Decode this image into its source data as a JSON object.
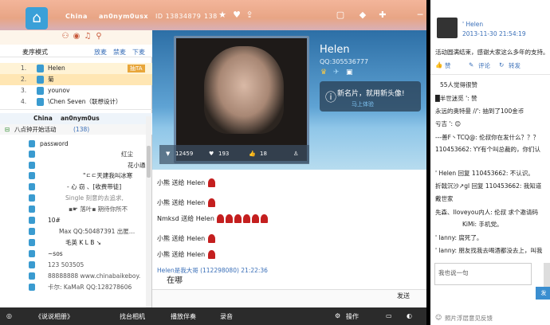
{
  "topbar": {
    "user1": "China",
    "user2": "an0nym0usx",
    "id_label": "ID 13834879",
    "fans_count": "138"
  },
  "left": {
    "mode_label": "麦序模式",
    "mode_options": [
      "放麦",
      "禁麦",
      "下麦"
    ],
    "mic_list": [
      {
        "num": "1.",
        "name": "Helen",
        "badge": "抽TA"
      },
      {
        "num": "2.",
        "name": "菊"
      },
      {
        "num": "3.",
        "name": "younov"
      },
      {
        "num": "4.",
        "name": "\\Chen Seven（联想设计）"
      }
    ],
    "room_head": [
      "China",
      "an0nym0us"
    ],
    "group_label": "八点钟开始活动",
    "group_count": "(138)",
    "members": [
      "password",
      "红尘",
      "花小通",
      "\"ㄷㄷ天建我叫冰寒",
      "- 心 窃 、[收费带徒]",
      "Single  刻意的去追求,",
      "▪☛ 落叶▪ 期待你所不",
      "10#",
      "Max   QQ:50487391  出匿…",
      "毛英  K L B  ↘",
      "~sos",
      "123  503505",
      "88888888  www.chinabaikeboy.",
      "卡尔: KaMaR  QQ:128278606"
    ]
  },
  "stage": {
    "host_name": "Helen",
    "host_qq": "QQ:305536777",
    "card_text": "新名片，就用新头像!",
    "card_link": "马上体验",
    "stats": [
      "12459",
      "193",
      "18"
    ]
  },
  "chat": {
    "messages": [
      {
        "text": "小熊  送给  Helen",
        "roses": 1
      },
      {
        "text": "小熊  送给  Helen",
        "roses": 1
      },
      {
        "text": "Nmksd  送给  Helen",
        "roses": 6
      },
      {
        "text": "小熊  送给  Helen",
        "roses": 1
      },
      {
        "text": "小熊  送给  Helen",
        "roses": 1
      }
    ],
    "last_sender": "Helen是我大哥 (112298080)  21:22:36",
    "last_text": "在哪",
    "send_label": "发送"
  },
  "bottombar": {
    "playlist": "《说说相册》",
    "items": [
      "找台相机",
      "播放伴奏",
      "录音",
      "操作"
    ]
  },
  "right": {
    "wb_name": "' Helen",
    "wb_time": "2013-11-30  21:54:19",
    "wb_text": "活动圆满结束，感谢大家这么多年的支持。",
    "actions": [
      "赞",
      "评论",
      "转发"
    ],
    "likes": "55人觉得很赞",
    "comments": [
      "█半世迷觅 ': 赞",
      "永远的奥特曼 //': 抽到了100金币",
      "亏吉 ': 😊",
      "---善F丶TCQ@: 伦叔你在发什么？？？",
      "110453662: YY有个叫总裁的，你们认",
      "' Helen 回复 110453662: 不认识。",
      "折戟沉沙↗gl 回复 110453662: 我知道",
      "戴世家",
      "先森、Iloveyou内人: 伦叔 求个邀请码",
      "KiMi: 手机党。",
      "' lanny: 腐死了。",
      "' lanny: 朋友找我去喝酒都没去上，叫我"
    ],
    "comment_placeholder": "我也说一句",
    "send": "发",
    "feedback": "照片浮层意见反馈"
  }
}
